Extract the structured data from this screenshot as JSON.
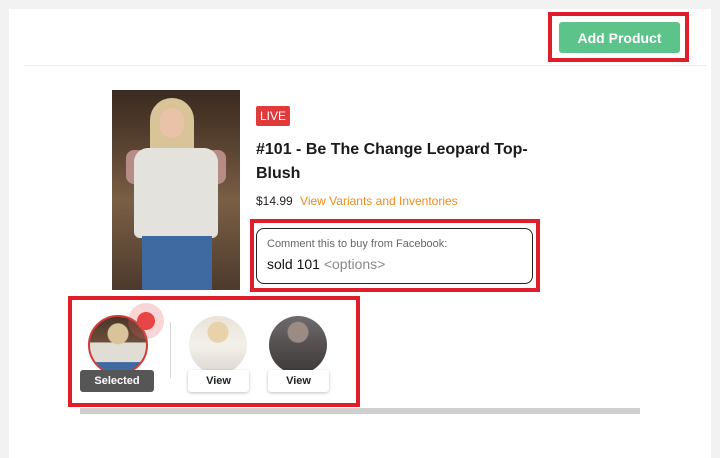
{
  "header": {
    "add_product_label": "Add Product"
  },
  "product": {
    "live_badge": "LIVE",
    "title": "#101 - Be The Change Leopard Top-Blush",
    "price": "$14.99",
    "variants_link": "View Variants and Inventories",
    "comment_caption": "Comment this to buy from Facebook:",
    "comment_command": "sold 101",
    "comment_options": "<options>"
  },
  "thumbnails": [
    {
      "label": "Selected",
      "state": "selected"
    },
    {
      "label": "View",
      "state": "default"
    },
    {
      "label": "View",
      "state": "default"
    }
  ],
  "colors": {
    "accent_green": "#5cc48b",
    "live_red": "#e03a3a",
    "link_orange": "#f08a1a",
    "highlight_red": "#e01e2b"
  }
}
